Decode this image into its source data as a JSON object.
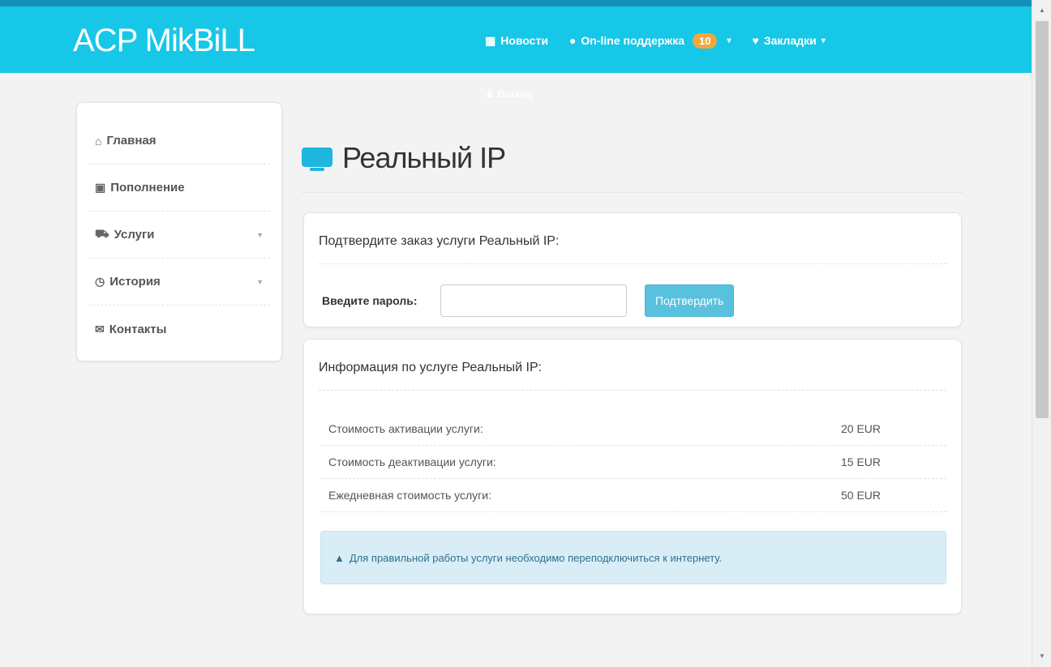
{
  "header": {
    "brand": "ACP MikBiLL",
    "nav": {
      "news_label": "Новости",
      "support_label": "On-line поддержка",
      "support_count": "10",
      "bookmarks_label": "Закладки"
    },
    "user_label": "Выход"
  },
  "sidebar": {
    "items": [
      {
        "label": "Главная",
        "icon": "home-icon"
      },
      {
        "label": "Пополнение",
        "icon": "money-icon"
      },
      {
        "label": "Услуги",
        "icon": "cart-icon"
      },
      {
        "label": "История",
        "icon": "clock-icon"
      },
      {
        "label": "Контакты",
        "icon": "envelope-icon"
      }
    ]
  },
  "page": {
    "title": "Реальный IP",
    "confirm_card": {
      "heading": "Подтвердите заказ услуги Реальный IP:",
      "password_label": "Введите пароль:",
      "password_value": "",
      "confirm_button": "Подтвердить"
    },
    "info_card": {
      "heading": "Информация по услуге Реальный IP:",
      "rows": [
        {
          "label": "Стоимость активации услуги:",
          "value": "20 EUR"
        },
        {
          "label": "Стоимость деактивации услуги:",
          "value": "15 EUR"
        },
        {
          "label": "Ежедневная стоимость услуги:",
          "value": "50 EUR"
        }
      ],
      "alert": "Для правильной работы услуги необходимо переподключиться к интернету."
    }
  },
  "colors": {
    "topbar": "#17c7e7",
    "accent": "#58c1de",
    "badge": "#f1a740",
    "alert_bg": "#d9edf7"
  }
}
